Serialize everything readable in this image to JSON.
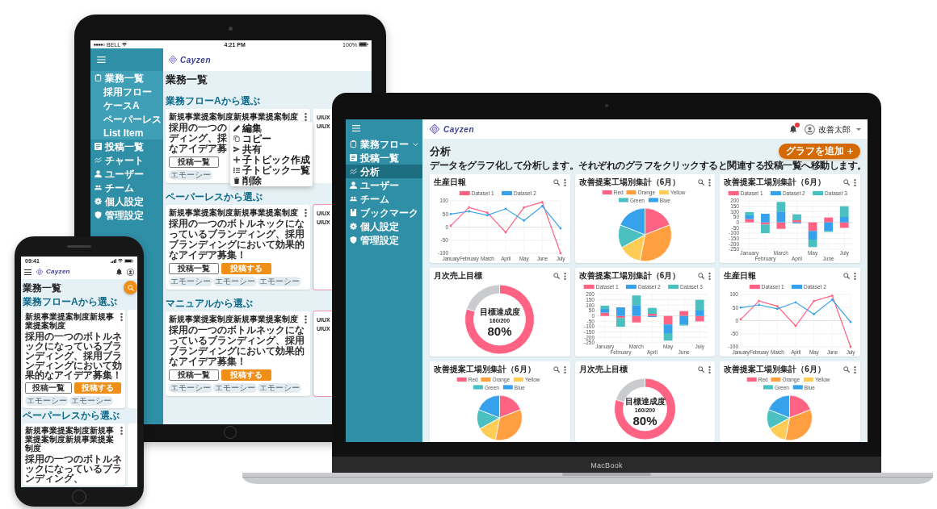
{
  "tablet": {
    "status_bar": {
      "carrier": "BELL",
      "time": "4:21 PM",
      "battery": "100%"
    },
    "logo": "Cayzen",
    "sidebar": [
      {
        "label": "業務一覧",
        "kind": "group",
        "selected": false,
        "expanded": true,
        "children": [
          {
            "label": "採用フロー",
            "selected": false
          },
          {
            "label": "ケースA",
            "selected": false
          },
          {
            "label": "ペーパーレス",
            "selected": false
          },
          {
            "label": "List Item",
            "selected": false
          }
        ]
      },
      {
        "label": "投稿一覧",
        "kind": "link",
        "selected": false
      },
      {
        "label": "チャート",
        "kind": "link",
        "selected": false
      },
      {
        "label": "ユーザー",
        "kind": "link",
        "selected": false
      },
      {
        "label": "チーム",
        "kind": "link",
        "selected": false
      },
      {
        "label": "個人設定",
        "kind": "link",
        "selected": false
      },
      {
        "label": "管理設定",
        "kind": "link",
        "selected": false
      }
    ],
    "page_title": "業務一覧",
    "sections": [
      {
        "heading": "業務フローAから選ぶ",
        "cards": [
          {
            "kind": "full",
            "highlighted": false,
            "title": "新規事業提案制度新規事業提案制度",
            "description_lines": [
              "採用の一つの",
              "ディング、採",
              "なアイデア募"
            ],
            "buttons": [
              {
                "label": "投稿一覧",
                "kind": "outline"
              }
            ],
            "tags": [
              "エモーシー"
            ]
          },
          {
            "kind": "peek",
            "highlighted": false,
            "title_lines": [
              "UIUX",
              "UIUX"
            ]
          }
        ]
      },
      {
        "heading": "ペーパーレスから選ぶ",
        "cards": [
          {
            "kind": "full",
            "highlighted": false,
            "title": "新規事業提案制度新規事業提案制度",
            "description": "採用の一つのボトルネックになっているブランディング、採用ブランディングにおいて効果的なアイデア募集！",
            "buttons": [
              {
                "label": "投稿一覧",
                "kind": "outline"
              },
              {
                "label": "投稿する",
                "kind": "primary"
              }
            ],
            "tags": [
              "エモーシー",
              "エモーシー",
              "エモーシー"
            ]
          },
          {
            "kind": "peek",
            "highlighted": true,
            "title_lines": [
              "UIUX",
              "UIUX"
            ]
          }
        ]
      },
      {
        "heading": "マニュアルから選ぶ",
        "cards": [
          {
            "kind": "full",
            "highlighted": false,
            "title": "新規事業提案制度新規事業提案制度",
            "description": "採用の一つのボトルネックになっているブランディング、採用ブランディングにおいて効果的なアイデア募集！",
            "buttons": [
              {
                "label": "投稿一覧",
                "kind": "outline"
              },
              {
                "label": "投稿する",
                "kind": "primary"
              }
            ],
            "tags": [
              "エモーシー",
              "エモーシー",
              "エモーシー"
            ]
          },
          {
            "kind": "peek",
            "highlighted": true,
            "title_lines": [
              "UIUX",
              "UIUX"
            ]
          }
        ]
      }
    ],
    "context_menu": [
      {
        "label": "編集"
      },
      {
        "label": "コピー"
      },
      {
        "label": "共有"
      },
      {
        "label": "子トピック作成"
      },
      {
        "label": "子トピック一覧"
      },
      {
        "label": "削除"
      }
    ]
  },
  "laptop": {
    "sidebar": [
      {
        "label": "業務フロー",
        "kind": "group",
        "selected": false,
        "expanded": false
      },
      {
        "label": "投稿一覧",
        "kind": "link",
        "selected": false
      },
      {
        "label": "分析",
        "kind": "link",
        "selected": true
      },
      {
        "label": "ユーザー",
        "kind": "link",
        "selected": false
      },
      {
        "label": "チーム",
        "kind": "link",
        "selected": false
      },
      {
        "label": "ブックマーク",
        "kind": "link",
        "selected": false
      },
      {
        "label": "個人設定",
        "kind": "link",
        "selected": false
      },
      {
        "label": "管理設定",
        "kind": "link",
        "selected": false
      }
    ],
    "logo": "Cayzen",
    "user": {
      "name": "改善太郎",
      "notification": true
    },
    "page_title": "分析",
    "description": "データをグラフ化して分析します。それぞれのグラフをクリックすると関連する投稿一覧へ移動します。",
    "add_button": "グラフを追加",
    "cards": [
      {
        "title": "生産日報",
        "chart_data": {
          "type": "line",
          "categories": [
            "January",
            "February",
            "March",
            "April",
            "May",
            "June",
            "July"
          ],
          "series": [
            {
              "name": "Dataset 1",
              "color": "#ff6384",
              "values": [
                5,
                75,
                55,
                -20,
                75,
                95,
                -100
              ]
            },
            {
              "name": "Dataset 2",
              "color": "#36a2eb",
              "values": [
                50,
                60,
                45,
                70,
                25,
                80,
                -5
              ]
            }
          ],
          "ylim": [
            -100,
            100
          ],
          "yticks": [
            -100,
            -50,
            0,
            50,
            100
          ],
          "grid": true,
          "legend": "top"
        }
      },
      {
        "title": "改善提案工場別集計（6月）",
        "chart_data": {
          "type": "pie",
          "categories": [
            "Red",
            "Orange",
            "Yellow",
            "Green",
            "Blue"
          ],
          "values": [
            19,
            34,
            14,
            14,
            19
          ],
          "colors": [
            "#ff6384",
            "#ff9f40",
            "#ffcd56",
            "#4bc0c0",
            "#36a2eb"
          ],
          "legend": "top"
        }
      },
      {
        "title": "改善提案工場別集計（6月）",
        "chart_data": {
          "type": "bar",
          "stacked": true,
          "categories": [
            "January",
            "February",
            "March",
            "April",
            "May",
            "June",
            "July"
          ],
          "series": [
            {
              "name": "Dataset 1",
              "color": "#ff6384",
              "values": [
                30,
                -20,
                -60,
                20,
                -80,
                45,
                -50
              ]
            },
            {
              "name": "Dataset 2",
              "color": "#36a2eb",
              "values": [
                35,
                80,
                100,
                -10,
                -80,
                -80,
                50
              ]
            },
            {
              "name": "Dataset 3",
              "color": "#4bc0c0",
              "values": [
                30,
                -80,
                90,
                55,
                -70,
                -10,
                100
              ]
            }
          ],
          "ylim": [
            -250,
            200
          ],
          "yticks": [
            -250,
            -200,
            -150,
            -100,
            -50,
            0,
            50,
            100,
            150,
            200
          ],
          "grid": true,
          "legend": "top"
        }
      },
      {
        "title": "月次売上目標",
        "chart_data": {
          "type": "donut",
          "values": [
            80,
            20
          ],
          "colors": [
            "#ff6384",
            "#c9cbcf"
          ]
        },
        "center_texts": [
          "目標達成度",
          "160/200",
          "80%"
        ]
      },
      {
        "title": "改善提案工場別集計（6月）",
        "chart_data": {
          "type": "bar",
          "stacked": true,
          "categories": [
            "January",
            "February",
            "March",
            "April",
            "May",
            "June",
            "July"
          ],
          "series": [
            {
              "name": "Dataset 1",
              "color": "#ff6384",
              "values": [
                30,
                -20,
                -60,
                20,
                -80,
                45,
                -50
              ]
            },
            {
              "name": "Dataset 2",
              "color": "#36a2eb",
              "values": [
                35,
                80,
                100,
                -10,
                -80,
                -80,
                50
              ]
            },
            {
              "name": "Dataset 3",
              "color": "#4bc0c0",
              "values": [
                30,
                -80,
                90,
                55,
                -70,
                -10,
                100
              ]
            }
          ],
          "ylim": [
            -250,
            200
          ],
          "yticks": [
            -250,
            -200,
            -150,
            -100,
            -50,
            0,
            50,
            100,
            150,
            200
          ],
          "grid": true,
          "legend": "top"
        }
      },
      {
        "title": "生産日報",
        "chart_data": {
          "type": "line",
          "categories": [
            "January",
            "February",
            "March",
            "April",
            "May",
            "June",
            "July"
          ],
          "series": [
            {
              "name": "Dataset 1",
              "color": "#ff6384",
              "values": [
                5,
                75,
                55,
                -20,
                75,
                95,
                -100
              ]
            },
            {
              "name": "Dataset 2",
              "color": "#36a2eb",
              "values": [
                50,
                60,
                45,
                70,
                25,
                80,
                -5
              ]
            }
          ],
          "ylim": [
            -100,
            100
          ],
          "yticks": [
            -100,
            -50,
            0,
            50,
            100
          ],
          "grid": true,
          "legend": "top"
        }
      },
      {
        "title": "改善提案工場別集計（6月）",
        "chart_data": {
          "type": "pie",
          "categories": [
            "Red",
            "Orange",
            "Yellow",
            "Green",
            "Blue"
          ],
          "values": [
            19,
            34,
            14,
            14,
            19
          ],
          "colors": [
            "#ff6384",
            "#ff9f40",
            "#ffcd56",
            "#4bc0c0",
            "#36a2eb"
          ],
          "legend": "top"
        }
      },
      {
        "title": "月次売上目標",
        "chart_data": {
          "type": "donut",
          "values": [
            80,
            20
          ],
          "colors": [
            "#ff6384",
            "#c9cbcf"
          ]
        },
        "center_texts": [
          "目標達成度",
          "160/200",
          "80%"
        ]
      },
      {
        "title": "改善提案工場別集計（6月）",
        "chart_data": {
          "type": "pie",
          "categories": [
            "Red",
            "Orange",
            "Yellow",
            "Green",
            "Blue"
          ],
          "values": [
            19,
            34,
            14,
            14,
            19
          ],
          "colors": [
            "#ff6384",
            "#ff9f40",
            "#ffcd56",
            "#4bc0c0",
            "#36a2eb"
          ],
          "legend": "top"
        }
      }
    ],
    "brand": "MacBook"
  },
  "phone": {
    "status_bar": {
      "time": "09:41"
    },
    "logo": "Cayzen",
    "page_title": "業務一覧",
    "sections": [
      {
        "heading": "業務フローAから選ぶ",
        "cards": [
          {
            "kind": "full",
            "highlighted": false,
            "title": "新規事業提案制度新規事業提案制度",
            "description": "採用の一つのボトルネックになっているブランディング、採用ブランディングにおいて効果的なアイデア募集！",
            "buttons": [
              {
                "label": "投稿一覧",
                "kind": "outline"
              },
              {
                "label": "投稿する",
                "kind": "primary"
              }
            ],
            "tags": [
              "エモーシー",
              "エモーシー"
            ]
          },
          {
            "kind": "peek",
            "highlighted": false
          }
        ]
      },
      {
        "heading": "ペーパーレスから選ぶ",
        "cards": [
          {
            "kind": "full",
            "highlighted": false,
            "title": "新規事業提案制度新規事業提案制度新規事業提案制度",
            "description": "採用の一つのボトルネックになっているブランディング、"
          },
          {
            "kind": "peek",
            "highlighted": false
          }
        ]
      }
    ]
  }
}
